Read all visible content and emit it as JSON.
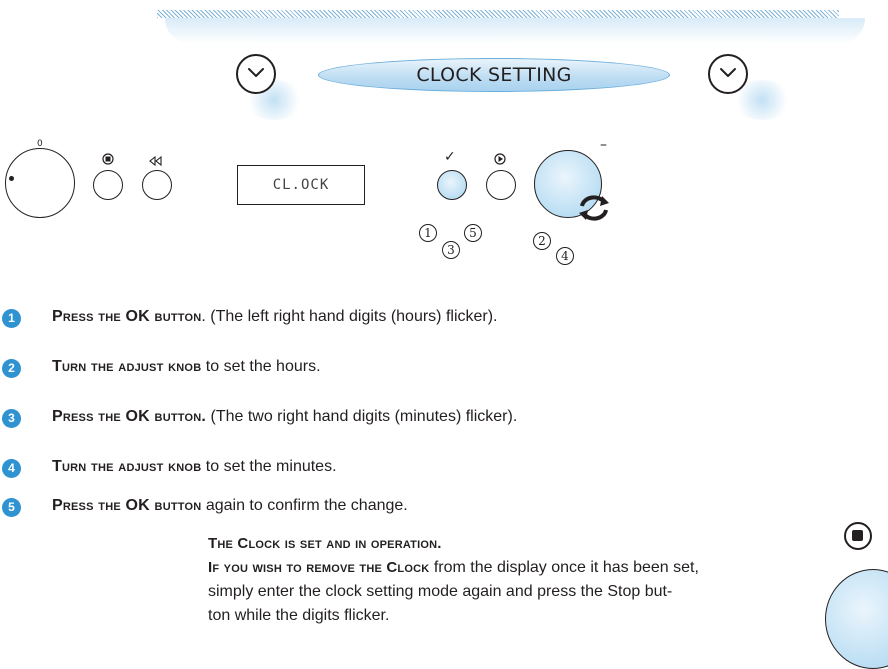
{
  "title": "CLOCK SETTING",
  "panel": {
    "knob_zero": "0",
    "display_text": "CL.OCK",
    "ok_mark": "✓",
    "minus_mark": "–",
    "circled_group_a": [
      "1",
      "3",
      "5"
    ],
    "circled_group_b": [
      "2",
      "4"
    ]
  },
  "icons": {
    "chevron": "chevron-down-icon",
    "stop": "stop-icon",
    "rewind": "rewind-icon",
    "play": "play-icon",
    "rotate": "rotate-arrows-icon"
  },
  "steps": [
    {
      "num": "1",
      "action": "Press the OK button",
      "rest": ". (The left right hand digits (hours) flicker)."
    },
    {
      "num": "2",
      "action": "Turn the adjust knob",
      "rest": " to set the hours."
    },
    {
      "num": "3",
      "action": "Press the OK button.",
      "rest": " (The two right hand digits (minutes) flicker)."
    },
    {
      "num": "4",
      "action": "Turn the adjust knob",
      "rest": " to set the minutes."
    },
    {
      "num": "5",
      "action": "Press the OK button",
      "rest": " again to confirm the change."
    }
  ],
  "note": {
    "heading": "The Clock is set and in operation.",
    "lead": "If you wish to remove the Clock",
    "line1_rest": " from the display once it has been set,",
    "line2": "simply enter the clock setting mode again and press the Stop but-",
    "line3": "ton while the digits flicker."
  },
  "colors": {
    "accent": "#2f93d1",
    "pill": "#bcdcf2",
    "text": "#231f20"
  }
}
